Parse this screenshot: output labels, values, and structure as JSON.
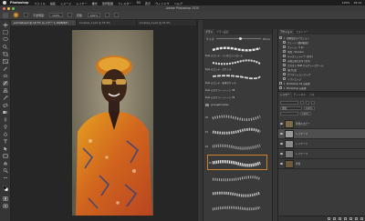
{
  "menubar": {
    "app": "Photoshop",
    "items": [
      "ファイル",
      "編集",
      "イメージ",
      "レイヤー",
      "書式",
      "選択範囲",
      "フィルター",
      "3D",
      "表示",
      "ウィンドウ",
      "ヘルプ"
    ]
  },
  "window": {
    "title": "Adobe Photoshop 2020"
  },
  "options": {
    "opacity_label": "不透明度:",
    "opacity_value": "100%",
    "flow_label": "流量:",
    "flow_value": "100%"
  },
  "doc_tabs": [
    "portrait.psd @ 16.7% (レイヤー 1, RGB/8#)",
    "brushes_1.psd @ 33.3%",
    "brushes_2.psd @ 33.3%"
  ],
  "brushes_panel": {
    "tabs": [
      "ブラシ",
      "ブラシ設定"
    ],
    "size_label": "サイズ:",
    "size_value": "65 px",
    "presets": [
      "Kyle のコンテ - ペン圧コントロール",
      "Kyle のコンテ - スケッチ",
      "Kyle のコンテ - 鉛筆スケッチ",
      "Kyle のスクリーントーン 38",
      "Kyle のスクリーントーン 39"
    ],
    "folder": "grungebrushes",
    "stroke_counts": [
      "65",
      "61",
      "64",
      "65"
    ]
  },
  "actions_panel": {
    "tabs": [
      "アクション",
      "ヒストリー"
    ],
    "items": [
      "初期設定のアクション",
      "フェード (選択範囲)",
      "フレーム - 5 px",
      "木目 - 50 pixel",
      "キャストシャドウ (文字)",
      "水面に映る文字 (文字)",
      "カスタム RGB からグレースケール",
      "溶けた鉛",
      "グラデーションマップ",
      "ソフトエッジ",
      "Photoshop CS の処理",
      "Photoshop の処理"
    ]
  },
  "layers_panel": {
    "tabs": [
      "レイヤー",
      "チャンネル",
      "パス"
    ],
    "blend_mode": "通常",
    "opacity_value": "100%",
    "fill_value": "100%",
    "layers": [
      {
        "name": "背景のコピー"
      },
      {
        "name": "レイヤー 2"
      },
      {
        "name": "レイヤー 1"
      },
      {
        "name": "レイヤー 3"
      },
      {
        "name": "背景"
      }
    ]
  },
  "status": {
    "clock": "18:14",
    "battery": "100%"
  }
}
